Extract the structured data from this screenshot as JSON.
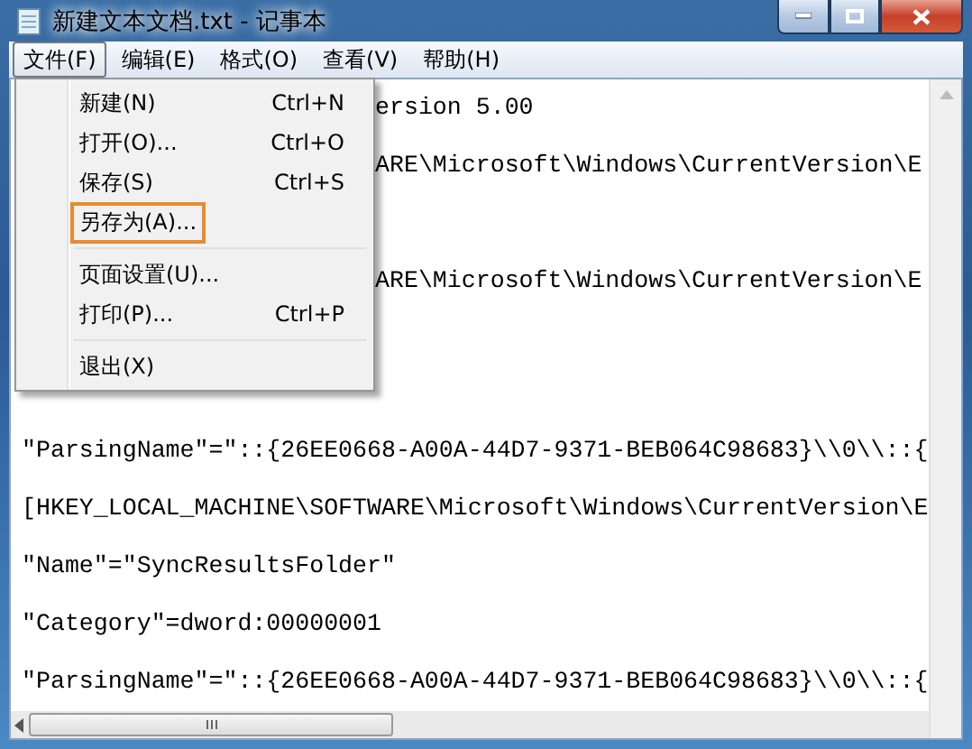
{
  "window": {
    "title": "新建文本文档.txt - 记事本"
  },
  "menubar": [
    {
      "label": "文件(F)",
      "selected": true
    },
    {
      "label": "编辑(E)",
      "selected": false
    },
    {
      "label": "格式(O)",
      "selected": false
    },
    {
      "label": "查看(V)",
      "selected": false
    },
    {
      "label": "帮助(H)",
      "selected": false
    }
  ],
  "file_menu": [
    {
      "kind": "item",
      "label": "新建(N)",
      "shortcut": "Ctrl+N",
      "highlighted": false
    },
    {
      "kind": "item",
      "label": "打开(O)...",
      "shortcut": "Ctrl+O",
      "highlighted": false
    },
    {
      "kind": "item",
      "label": "保存(S)",
      "shortcut": "Ctrl+S",
      "highlighted": false
    },
    {
      "kind": "item",
      "label": "另存为(A)...",
      "highlighted": true
    },
    {
      "kind": "separator"
    },
    {
      "kind": "item",
      "label": "页面设置(U)...",
      "highlighted": false
    },
    {
      "kind": "item",
      "label": "打印(P)...",
      "shortcut": "Ctrl+P",
      "highlighted": false
    },
    {
      "kind": "separator"
    },
    {
      "kind": "item",
      "label": "退出(X)",
      "highlighted": false
    }
  ],
  "editor_lines": [
    {
      "kind": "partial",
      "text": "ersion 5.00"
    },
    {
      "kind": "partial",
      "text": "ARE\\Microsoft\\Windows\\CurrentVersion\\E"
    },
    {
      "kind": "partial",
      "text": "ARE\\Microsoft\\Windows\\CurrentVersion\\E",
      "gap_before": true
    },
    {
      "kind": "full",
      "text": "\"ParsingName\"=\"::{26EE0668-A00A-44D7-9371-BEB064C98683}\\\\0\\\\::{"
    },
    {
      "kind": "full",
      "text": "[HKEY_LOCAL_MACHINE\\SOFTWARE\\Microsoft\\Windows\\CurrentVersion\\E"
    },
    {
      "kind": "full",
      "text": "\"Name\"=\"SyncResultsFolder\""
    },
    {
      "kind": "full",
      "text": "\"Category\"=dword:00000001"
    },
    {
      "kind": "full",
      "text": "\"ParsingName\"=\"::{26EE0668-A00A-44D7-9371-BEB064C98683}\\\\0\\\\::{"
    }
  ]
}
